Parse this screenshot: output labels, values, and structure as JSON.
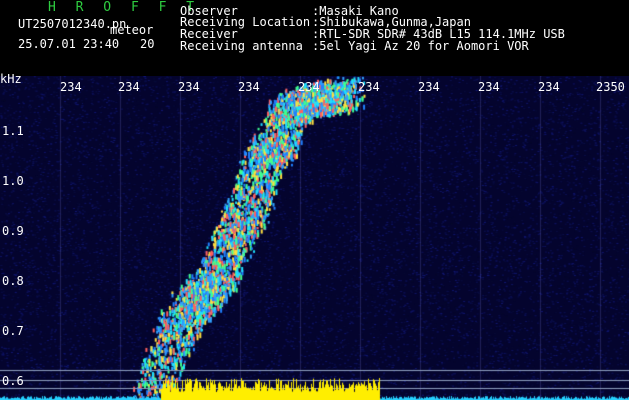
{
  "header": {
    "title": "H R O F F T",
    "filename": "UT2507012340.pn",
    "filename_suffix": "meteor",
    "timestamp": "25.07.01 23:40",
    "count": "20"
  },
  "info": [
    {
      "label": "Observer",
      "value": ":Masaki Kano"
    },
    {
      "label": "Receiving Location",
      "value": ":Shibukawa,Gunma,Japan"
    },
    {
      "label": "Receiver",
      "value": ":RTL-SDR SDR# 43dB L15 114.1MHz USB"
    },
    {
      "label": "Receiving antenna",
      "value": ":5el Yagi Az 20 for Aomori VOR"
    }
  ],
  "x_ticks": [
    "234",
    "234",
    "234",
    "234",
    "234",
    "234",
    "234",
    "234",
    "234",
    "2350"
  ],
  "y_axis": {
    "unit": "kHz",
    "ticks": [
      "1.1",
      "1.0",
      "0.9",
      "0.8",
      "0.7",
      "0.6"
    ]
  },
  "colors": {
    "title": "#2ecc40",
    "noise": "#0a0a50",
    "echo": "#26d0ff",
    "amp": "#ffee00",
    "guide": "#8fa0c0"
  }
}
